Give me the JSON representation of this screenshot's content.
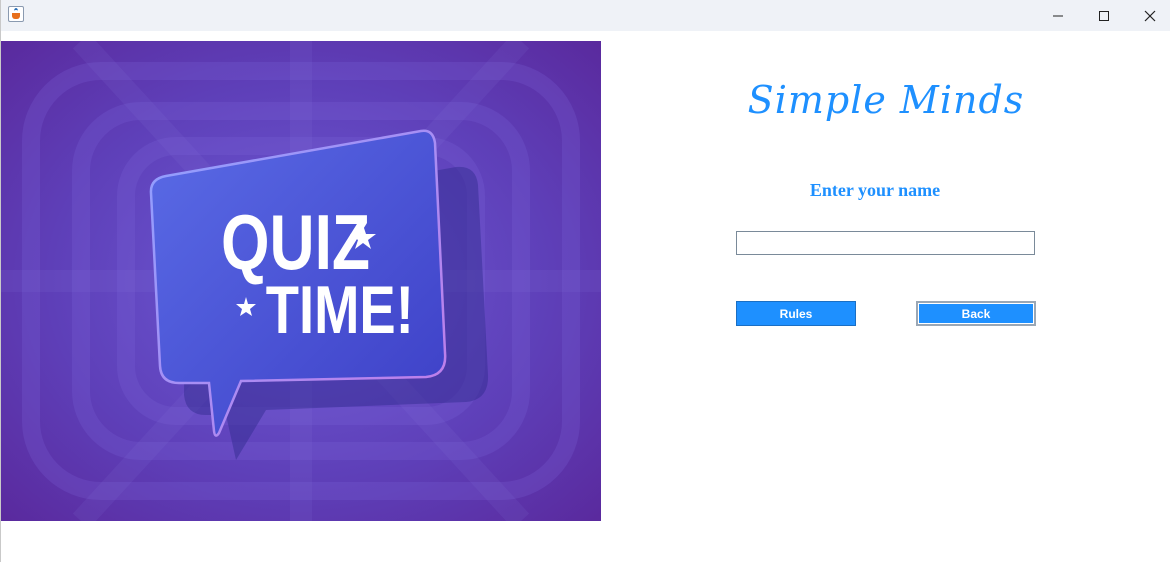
{
  "window": {
    "controls": {
      "minimize": "minimize-icon",
      "maximize": "maximize-icon",
      "close": "close-icon"
    }
  },
  "hero": {
    "line1": "QUIZ",
    "line2": "TIME!",
    "colors": {
      "bg_outer": "#5b2ea6",
      "bg_inner": "#6a4fd0",
      "bubble": "#4e55d8",
      "bubble_edge": "#b07de6"
    }
  },
  "form": {
    "title": "Simple Minds",
    "prompt": "Enter your name",
    "name_value": "",
    "rules_label": "Rules",
    "back_label": "Back"
  },
  "colors": {
    "accent": "#1e90ff",
    "titlebar": "#eff2f7"
  }
}
